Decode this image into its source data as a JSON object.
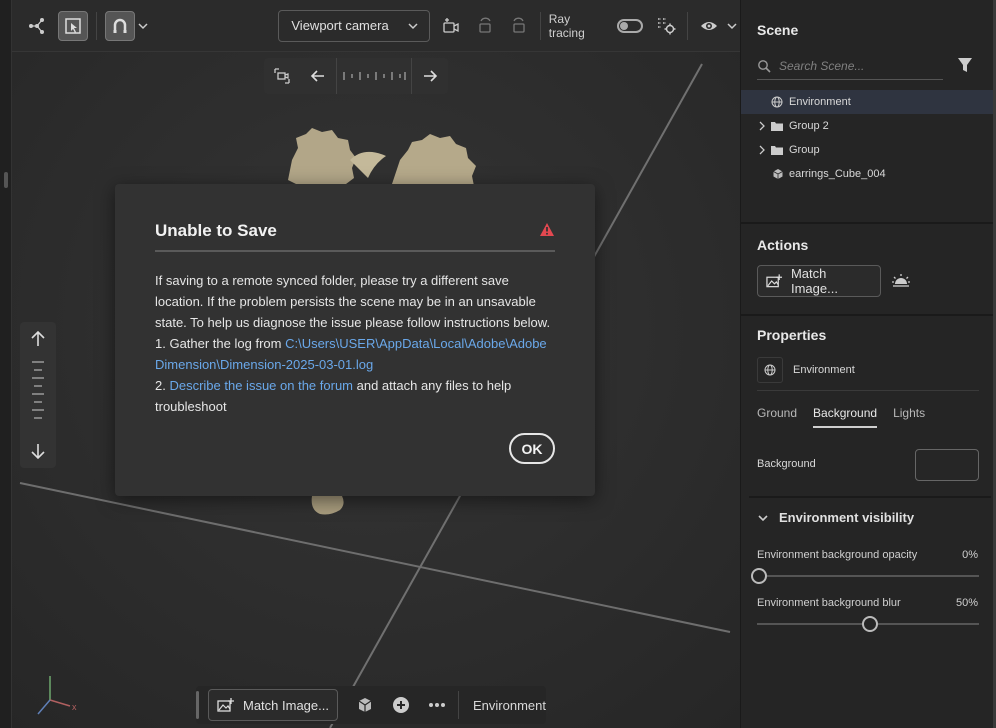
{
  "toolbar": {
    "camera_select": "Viewport camera",
    "ray_tracing_label": "Ray tracing",
    "icons": [
      "scene-graph-icon",
      "select-tool-icon",
      "magnet-snap-icon",
      "chevron-down-icon",
      "camera-bookmark-icon",
      "undo-camera-icon",
      "redo-camera-icon",
      "ray-tracing-toggle",
      "render-settings-icon",
      "visibility-eye-icon"
    ]
  },
  "bottom_toolbar": {
    "match_image_label": "Match Image...",
    "context_label": "Environment"
  },
  "dialog": {
    "title": "Unable to Save",
    "paragraph": "If saving to a remote synced folder, please try a different save location. If the problem persists the scene may be in an unsavable state. To help us diagnose the issue please follow instructions below.",
    "step1_prefix": "1. Gather the log from ",
    "step1_link": "C:\\Users\\USER\\AppData\\Local\\Adobe\\Adobe Dimension\\Dimension-2025-03-01.log",
    "step2_prefix": "2. ",
    "step2_link": "Describe the issue on the forum",
    "step2_suffix": " and attach any files to help troubleshoot",
    "ok_label": "OK",
    "colors": {
      "warning": "#e34850",
      "link": "#6aa8ea"
    }
  },
  "scene_panel": {
    "title": "Scene",
    "search_placeholder": "Search Scene...",
    "items": [
      {
        "label": "Environment",
        "icon": "globe-icon",
        "expandable": false,
        "selected": true
      },
      {
        "label": "Group 2",
        "icon": "folder-icon",
        "expandable": true,
        "selected": false
      },
      {
        "label": "Group",
        "icon": "folder-icon",
        "expandable": true,
        "selected": false
      },
      {
        "label": "earrings_Cube_004",
        "icon": "cube-icon",
        "expandable": false,
        "selected": false
      }
    ]
  },
  "actions_panel": {
    "title": "Actions",
    "match_image_label": "Match Image..."
  },
  "properties_panel": {
    "title": "Properties",
    "object_label": "Environment",
    "tabs": [
      "Ground",
      "Background",
      "Lights"
    ],
    "active_tab": "Background",
    "background_label": "Background",
    "visibility_section": "Environment visibility",
    "sliders": [
      {
        "label": "Environment background opacity",
        "value_text": "0%",
        "value": 0
      },
      {
        "label": "Environment background blur",
        "value_text": "50%",
        "value": 50
      }
    ]
  }
}
